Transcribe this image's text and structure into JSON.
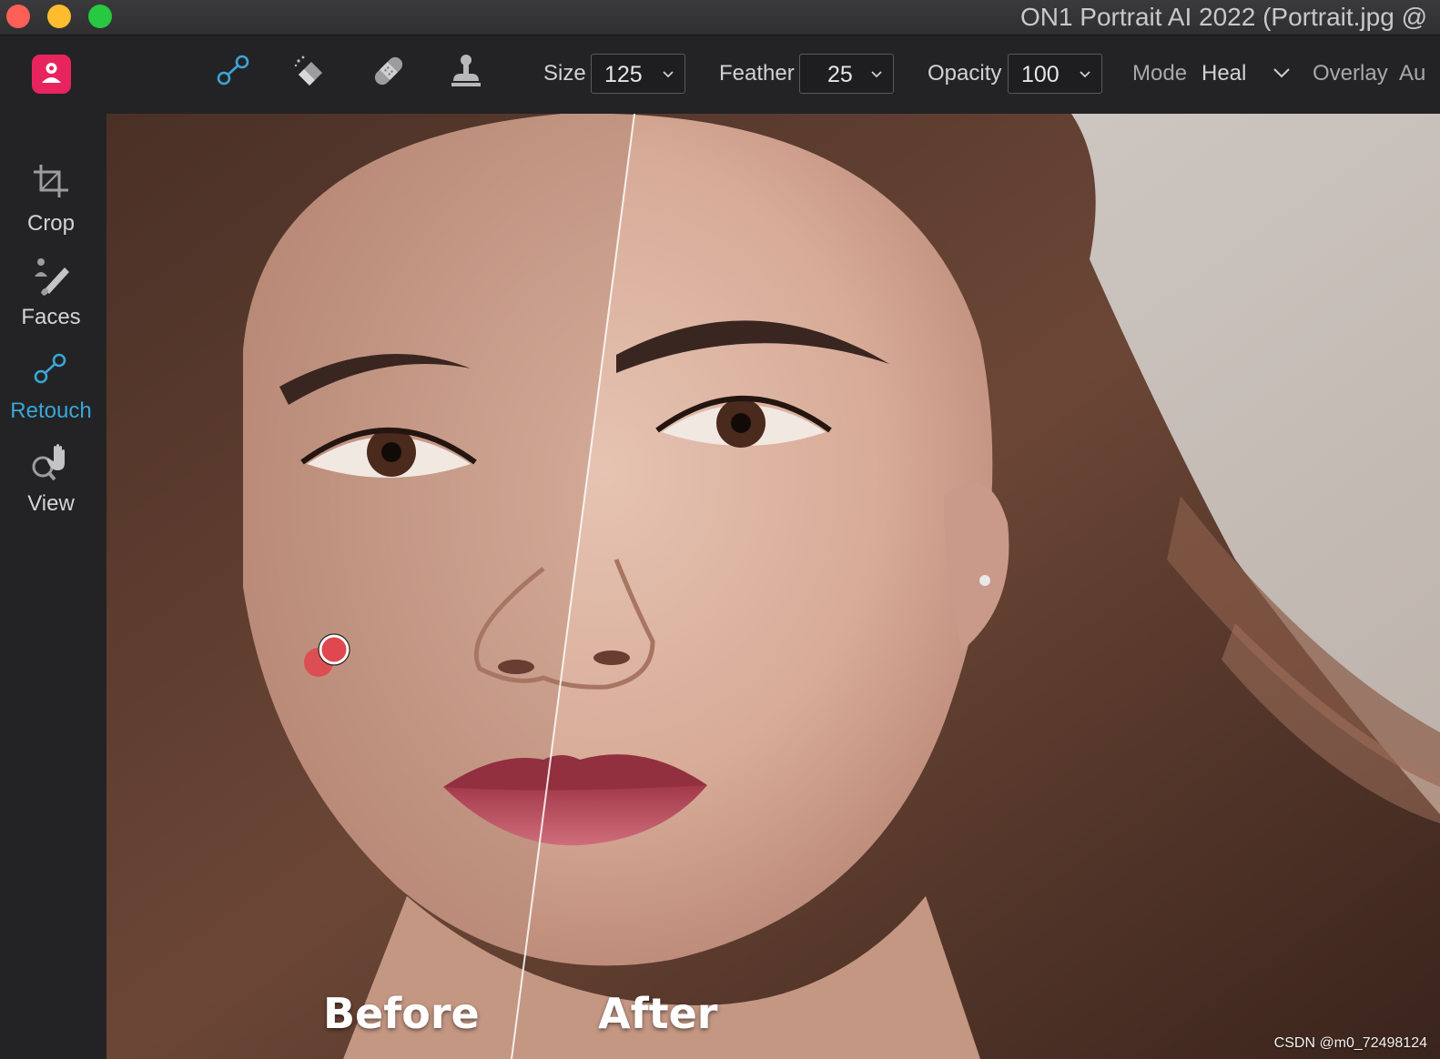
{
  "window": {
    "title": "ON1 Portrait AI 2022 (Portrait.jpg @"
  },
  "toolbar": {
    "tools": [
      {
        "name": "retouch-tool",
        "icon": "retouch-icon"
      },
      {
        "name": "eraser-tool",
        "icon": "eraser-icon"
      },
      {
        "name": "bandaid-tool",
        "icon": "bandaid-icon"
      },
      {
        "name": "clone-stamp-tool",
        "icon": "clone-stamp-icon"
      }
    ],
    "size": {
      "label": "Size",
      "value": "125"
    },
    "feather": {
      "label": "Feather",
      "value": "25"
    },
    "opacity": {
      "label": "Opacity",
      "value": "100"
    },
    "mode": {
      "label": "Mode",
      "value": "Heal"
    },
    "overlay_label": "Overlay",
    "auto_label": "Au"
  },
  "sidebar": {
    "items": [
      {
        "label": "Crop",
        "icon": "crop-icon",
        "active": false
      },
      {
        "label": "Faces",
        "icon": "faces-icon",
        "active": false
      },
      {
        "label": "Retouch",
        "icon": "retouch-icon",
        "active": true
      },
      {
        "label": "View",
        "icon": "view-icon",
        "active": false
      }
    ]
  },
  "canvas": {
    "before_label": "Before",
    "after_label": "After",
    "watermark": "CSDN @m0_72498124"
  },
  "colors": {
    "accent_blue": "#3aa6d8",
    "app_logo": "#e8245f",
    "brush_red": "#e0474f"
  }
}
